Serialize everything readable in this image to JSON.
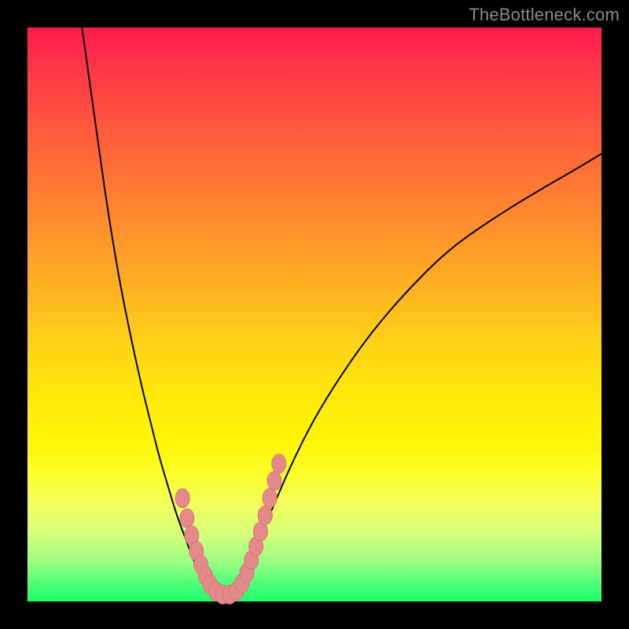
{
  "watermark": "TheBottleneck.com",
  "colors": {
    "curve_stroke": "#000000",
    "marker_fill": "#e58a8a",
    "marker_stroke": "#d87575",
    "frame_bg": "#000000"
  },
  "chart_data": {
    "type": "line",
    "title": "",
    "xlabel": "",
    "ylabel": "",
    "xlim": [
      0,
      100
    ],
    "ylim": [
      0,
      100
    ],
    "grid": false,
    "legend": "none",
    "series": [
      {
        "name": "left-branch",
        "x": [
          9.5,
          12,
          14,
          16,
          18,
          20,
          21.5,
          23,
          24.5,
          26,
          27.5,
          29,
          30.5,
          32
        ],
        "y": [
          100,
          82,
          68,
          56,
          46,
          37,
          31,
          25,
          20,
          15,
          11,
          7,
          4,
          1.5
        ]
      },
      {
        "name": "right-branch",
        "x": [
          36,
          38,
          40,
          43,
          46,
          50,
          55,
          60,
          66,
          73,
          80,
          88,
          95,
          100
        ],
        "y": [
          1.5,
          5,
          10,
          17,
          24,
          32,
          40,
          47,
          54,
          61,
          66,
          71,
          75,
          78
        ]
      },
      {
        "name": "markers",
        "style": "scatter",
        "x": [
          27.0,
          27.8,
          28.6,
          29.4,
          30.2,
          31.0,
          31.8,
          32.8,
          34.0,
          35.2,
          36.4,
          37.4,
          38.2,
          39.0,
          39.8,
          40.6,
          41.4,
          42.2,
          43.0,
          43.8
        ],
        "y": [
          18.0,
          14.5,
          11.5,
          8.8,
          6.4,
          4.5,
          3.0,
          1.8,
          1.2,
          1.2,
          1.8,
          3.2,
          5.0,
          7.2,
          9.6,
          12.2,
          15.0,
          18.0,
          21.0,
          24.0
        ]
      }
    ]
  }
}
